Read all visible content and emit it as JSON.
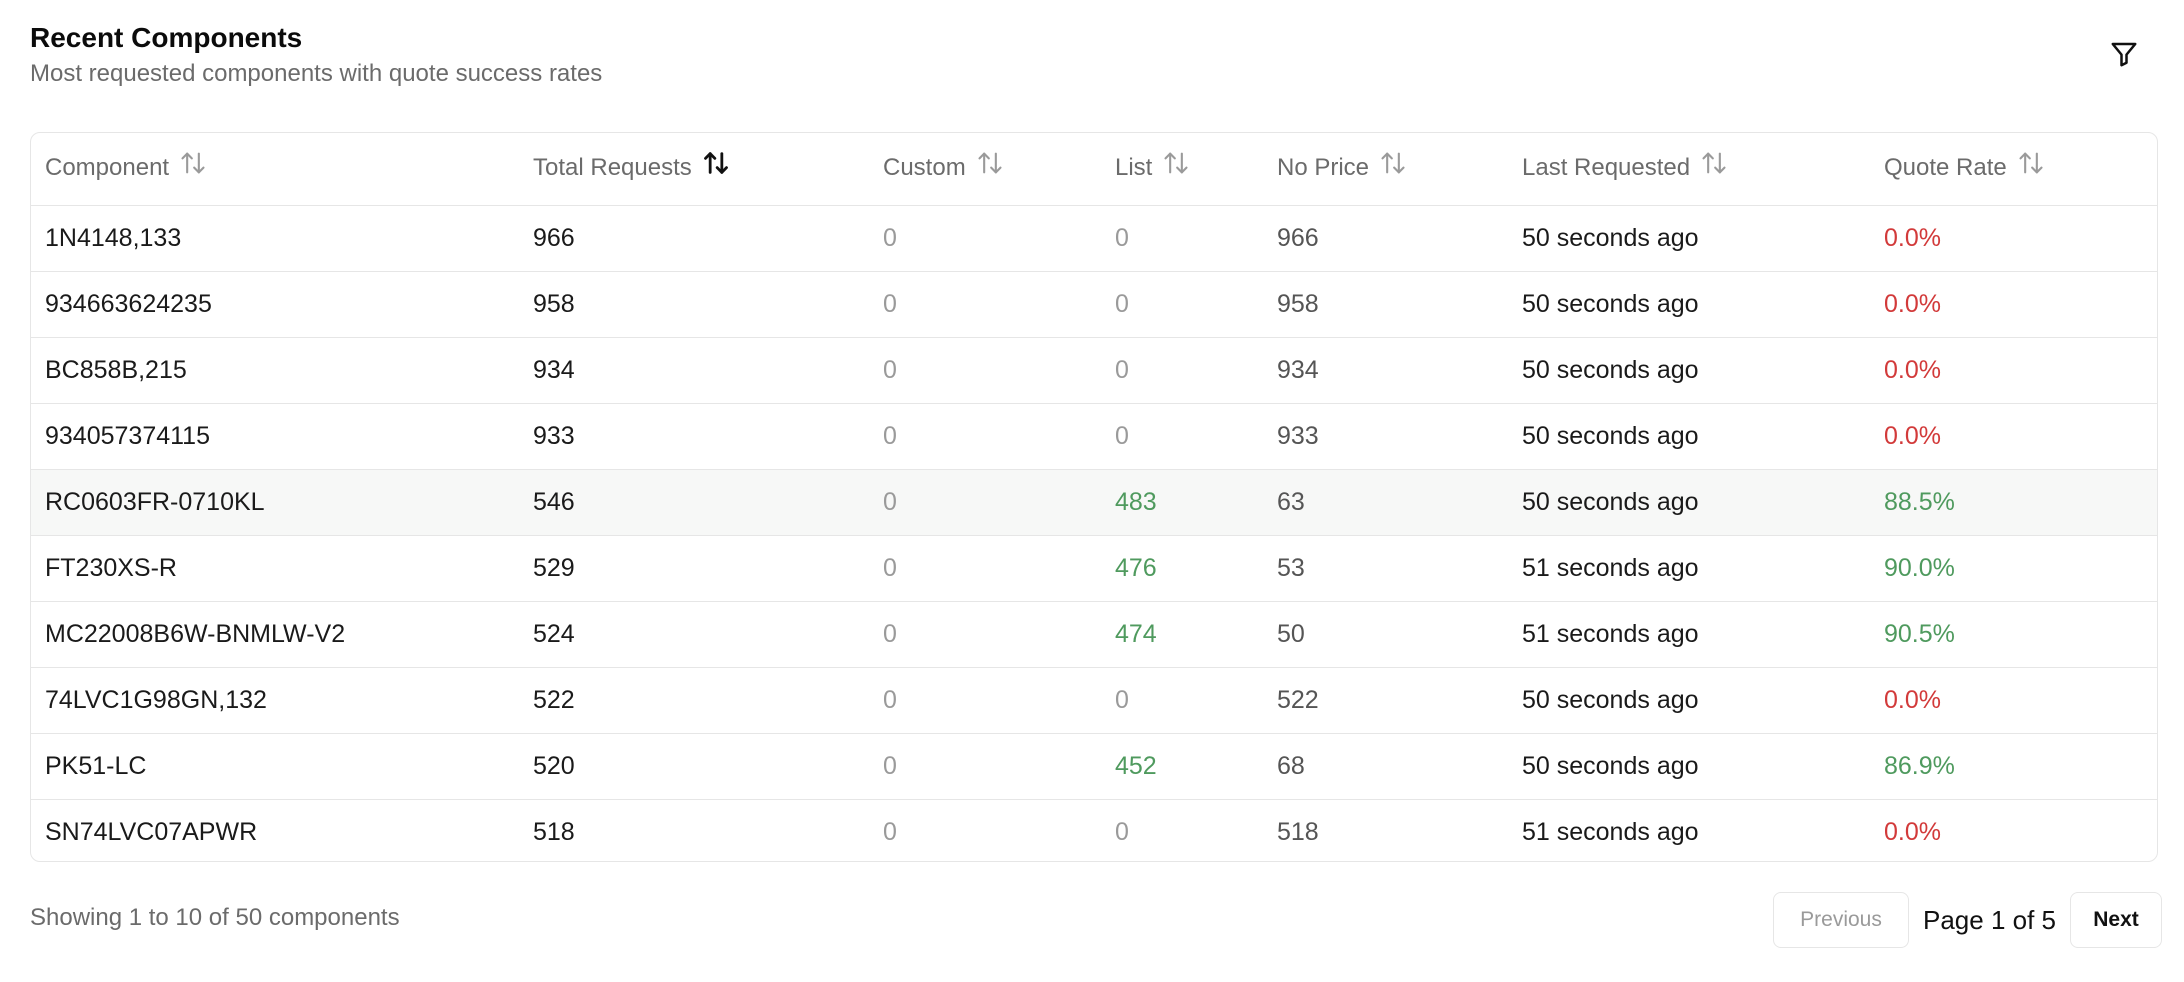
{
  "header": {
    "title": "Recent Components",
    "subtitle": "Most requested components with quote success rates"
  },
  "table": {
    "columns": [
      {
        "label": "Component",
        "sorted": false
      },
      {
        "label": "Total Requests",
        "sorted": true
      },
      {
        "label": "Custom",
        "sorted": false
      },
      {
        "label": "List",
        "sorted": false
      },
      {
        "label": "No Price",
        "sorted": false
      },
      {
        "label": "Last Requested",
        "sorted": false
      },
      {
        "label": "Quote Rate",
        "sorted": false
      }
    ],
    "rows": [
      {
        "component": "1N4148,133",
        "total": "966",
        "custom": "0",
        "list": "0",
        "no_price": "966",
        "last": "50 seconds ago",
        "rate": "0.0%"
      },
      {
        "component": "934663624235",
        "total": "958",
        "custom": "0",
        "list": "0",
        "no_price": "958",
        "last": "50 seconds ago",
        "rate": "0.0%"
      },
      {
        "component": "BC858B,215",
        "total": "934",
        "custom": "0",
        "list": "0",
        "no_price": "934",
        "last": "50 seconds ago",
        "rate": "0.0%"
      },
      {
        "component": "934057374115",
        "total": "933",
        "custom": "0",
        "list": "0",
        "no_price": "933",
        "last": "50 seconds ago",
        "rate": "0.0%"
      },
      {
        "component": "RC0603FR-0710KL",
        "total": "546",
        "custom": "0",
        "list": "483",
        "no_price": "63",
        "last": "50 seconds ago",
        "rate": "88.5%"
      },
      {
        "component": "FT230XS-R",
        "total": "529",
        "custom": "0",
        "list": "476",
        "no_price": "53",
        "last": "51 seconds ago",
        "rate": "90.0%"
      },
      {
        "component": "MC22008B6W-BNMLW-V2",
        "total": "524",
        "custom": "0",
        "list": "474",
        "no_price": "50",
        "last": "51 seconds ago",
        "rate": "90.5%"
      },
      {
        "component": "74LVC1G98GN,132",
        "total": "522",
        "custom": "0",
        "list": "0",
        "no_price": "522",
        "last": "50 seconds ago",
        "rate": "0.0%"
      },
      {
        "component": "PK51-LC",
        "total": "520",
        "custom": "0",
        "list": "452",
        "no_price": "68",
        "last": "50 seconds ago",
        "rate": "86.9%"
      },
      {
        "component": "SN74LVC07APWR",
        "total": "518",
        "custom": "0",
        "list": "0",
        "no_price": "518",
        "last": "51 seconds ago",
        "rate": "0.0%"
      }
    ]
  },
  "footer": {
    "showing": "Showing 1 to 10 of 50 components",
    "previous_label": "Previous",
    "page_label": "Page 1 of 5",
    "next_label": "Next"
  },
  "icons": {
    "filter": "filter-icon",
    "sort": "sort-arrows-icon"
  },
  "colors": {
    "positive": "#4f9a5e",
    "negative": "#d23a3a",
    "muted": "#9a9a9a"
  }
}
